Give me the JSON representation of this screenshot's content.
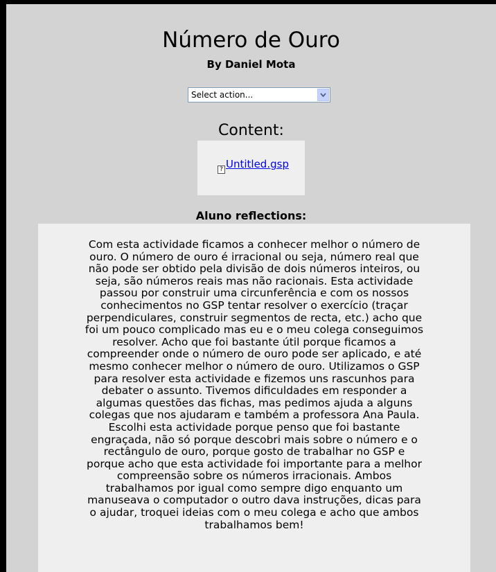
{
  "title": "Número de Ouro",
  "byline": "By Daniel Mota",
  "action_select": {
    "value": "Select action..."
  },
  "content_heading": "Content:",
  "file": {
    "name": "Untitled.gsp",
    "icon": "unknown-file-icon",
    "icon_glyph": "?"
  },
  "reflections_heading": "Aluno reflections:",
  "reflection_text": "Com esta actividade ficamos a conhecer melhor o número de\nouro. O número de ouro é irracional ou seja, número real que\nnão pode ser obtido pela divisão de dois números inteiros, ou\nseja, são números reais mas não racionais. Esta actividade\npassou por construir uma circunferência e com os nossos\nconhecimentos no GSP tentar resolver o exercício (traçar\nperpendiculares, construir segmentos de recta, etc.) acho que\nfoi um pouco complicado mas eu e o meu colega conseguimos\nresolver. Acho que foi bastante útil porque ficamos a\ncompreender onde o número de ouro pode ser aplicado, e até\nmesmo conhecer melhor o número de ouro. Utilizamos o GSP\npara resolver esta actividade e fizemos uns rascunhos para\ndebater o assunto. Tivemos dificuldades em responder a\nalgumas questões das fichas, mas pedimos ajuda a alguns\ncolegas que nos ajudaram e também a professora Ana Paula.\nEscolhi esta actividade porque penso que foi bastante\nengraçada, não só porque descobri mais sobre o número e o\nrectângulo de ouro, porque gosto de trabalhar no GSP e\nporque acho que esta actividade foi importante para a melhor\ncompreensão sobre os números irracionais. Ambos\ntrabalhamos por igual como sempre digo enquanto um\nmanuseava o computador o outro dava instruções, dicas para\no ajudar, troquei ideias com o meu colega e acho que ambos\ntrabalhamos bem!"
}
